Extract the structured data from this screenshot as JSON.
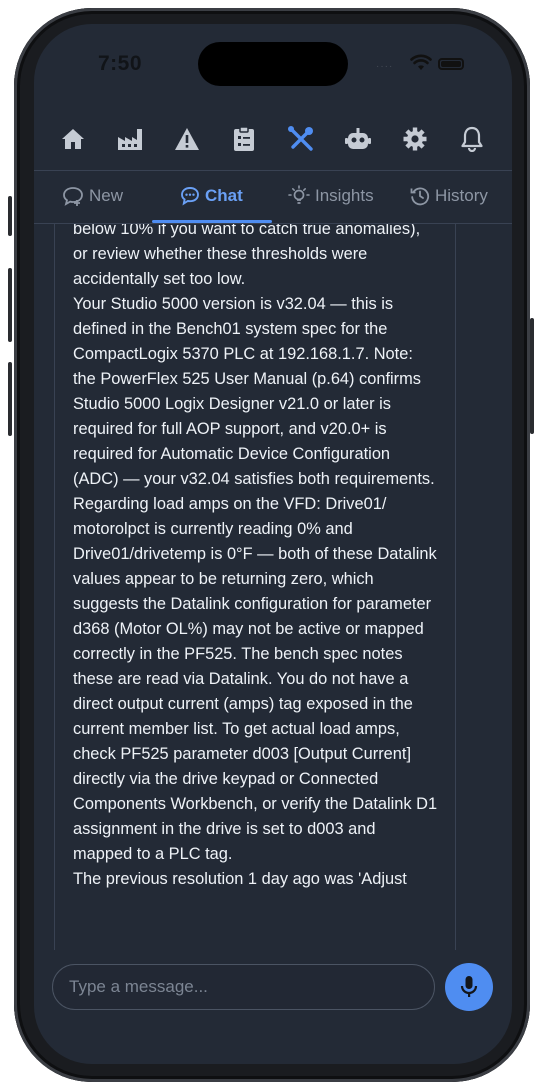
{
  "status_bar": {
    "time": "7:50",
    "signal": "····"
  },
  "toolbar": {
    "icons": [
      "home-icon",
      "factory-icon",
      "warning-icon",
      "clipboard-icon",
      "tools-icon",
      "robot-icon",
      "gear-icon",
      "bell-icon"
    ],
    "active_color": "#4f8df1",
    "inactive_color": "#c5cbd4"
  },
  "tabs": [
    {
      "label": "New",
      "icon": "chat-plus-icon"
    },
    {
      "label": "Chat",
      "icon": "chat-bubble-icon"
    },
    {
      "label": "Insights",
      "icon": "lightbulb-icon"
    },
    {
      "label": "History",
      "icon": "history-icon"
    }
  ],
  "message": {
    "paragraphs": [
      "below 10% if you want to catch true anomalies), or review whether these thresholds were accidentally set too low.",
      "Your Studio 5000 version is v32.04 — this is defined in the Bench01 system spec for the CompactLogix 5370 PLC at 192.168.1.7. Note: the PowerFlex 525 User Manual (p.64) confirms Studio 5000 Logix Designer v21.0 or later is required for full AOP support, and v20.0+ is required for Automatic Device Configuration (ADC) — your v32.04 satisfies both requirements.",
      "Regarding load amps on the VFD: Drive01/ motorolpct is currently reading 0% and Drive01/drivetemp is 0°F — both of these Datalink values appear to be returning zero, which suggests the Datalink configuration for parameter d368 (Motor OL%) may not be active or mapped correctly in the PF525. The bench spec notes these are read via Datalink. You do not have a direct output current (amps) tag exposed in the current member list. To get actual load amps, check PF525 parameter d003 [Output Current] directly via the drive keypad or Connected Components Workbench, or verify the Datalink D1 assignment in the drive is set to d003 and mapped to a PLC tag.",
      "The previous resolution 1 day ago was 'Adjust"
    ]
  },
  "input": {
    "placeholder": "Type a message..."
  },
  "colors": {
    "accent": "#4f8df1",
    "background": "#232a36",
    "text": "#eef2f7",
    "muted": "#8d96a4"
  }
}
